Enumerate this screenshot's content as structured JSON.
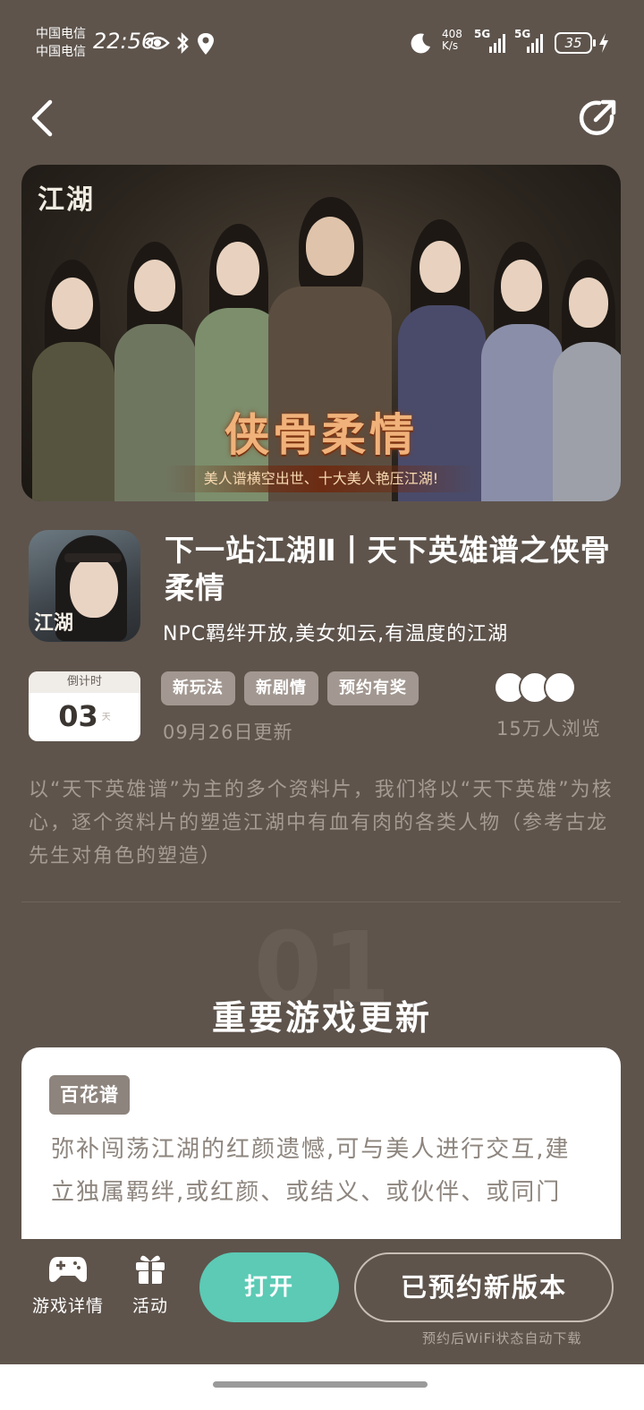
{
  "status_bar": {
    "carrier_1": "中国电信",
    "carrier_2": "中国电信",
    "time": "22:56",
    "net_speed_value": "408",
    "net_speed_unit": "K/s",
    "signal_1_label": "5G",
    "signal_2_label": "5G",
    "battery": "35",
    "icons": [
      "eye-icon",
      "bluetooth-icon",
      "location-icon",
      "moon-icon",
      "signal-icon",
      "charging-icon"
    ]
  },
  "nav": {
    "back_icon": "chevron-left-icon",
    "share_icon": "share-icon"
  },
  "banner": {
    "logo": "江湖",
    "title": "侠骨柔情",
    "subtitle": "美人谱横空出世、十大美人艳压江湖!"
  },
  "app": {
    "icon_text": "江湖",
    "title": "下一站江湖Ⅱ丨天下英雄谱之侠骨柔情",
    "subtitle": "NPC羁绊开放,美女如云,有温度的江湖"
  },
  "countdown": {
    "label": "倒计时",
    "value": "03",
    "unit": "天"
  },
  "tags": [
    "新玩法",
    "新剧情",
    "预约有奖"
  ],
  "update_date": "09月26日更新",
  "views": "15万人浏览",
  "description": "以“天下英雄谱”为主的多个资料片，我们将以“天下英雄”为核心，逐个资料片的塑造江湖中有血有肉的各类人物（参考古龙先生对角色的塑造）",
  "section": {
    "number": "01",
    "title": "重要游戏更新"
  },
  "card": {
    "tag": "百花谱",
    "text": "弥补闯荡江湖的红颜遗憾,可与美人进行交互,建立独属羁绊,或红颜、或结义、或伙伴、或同门"
  },
  "bottom_bar": {
    "game_details_label": "游戏详情",
    "activity_label": "活动",
    "open_label": "打开",
    "reserve_label": "已预约新版本",
    "reserve_note": "预约后WiFi状态自动下载"
  },
  "colors": {
    "background": "#5e544c",
    "open_button": "#5ccab5",
    "tag": "#a29891",
    "banner_title": "#f0b27a"
  }
}
